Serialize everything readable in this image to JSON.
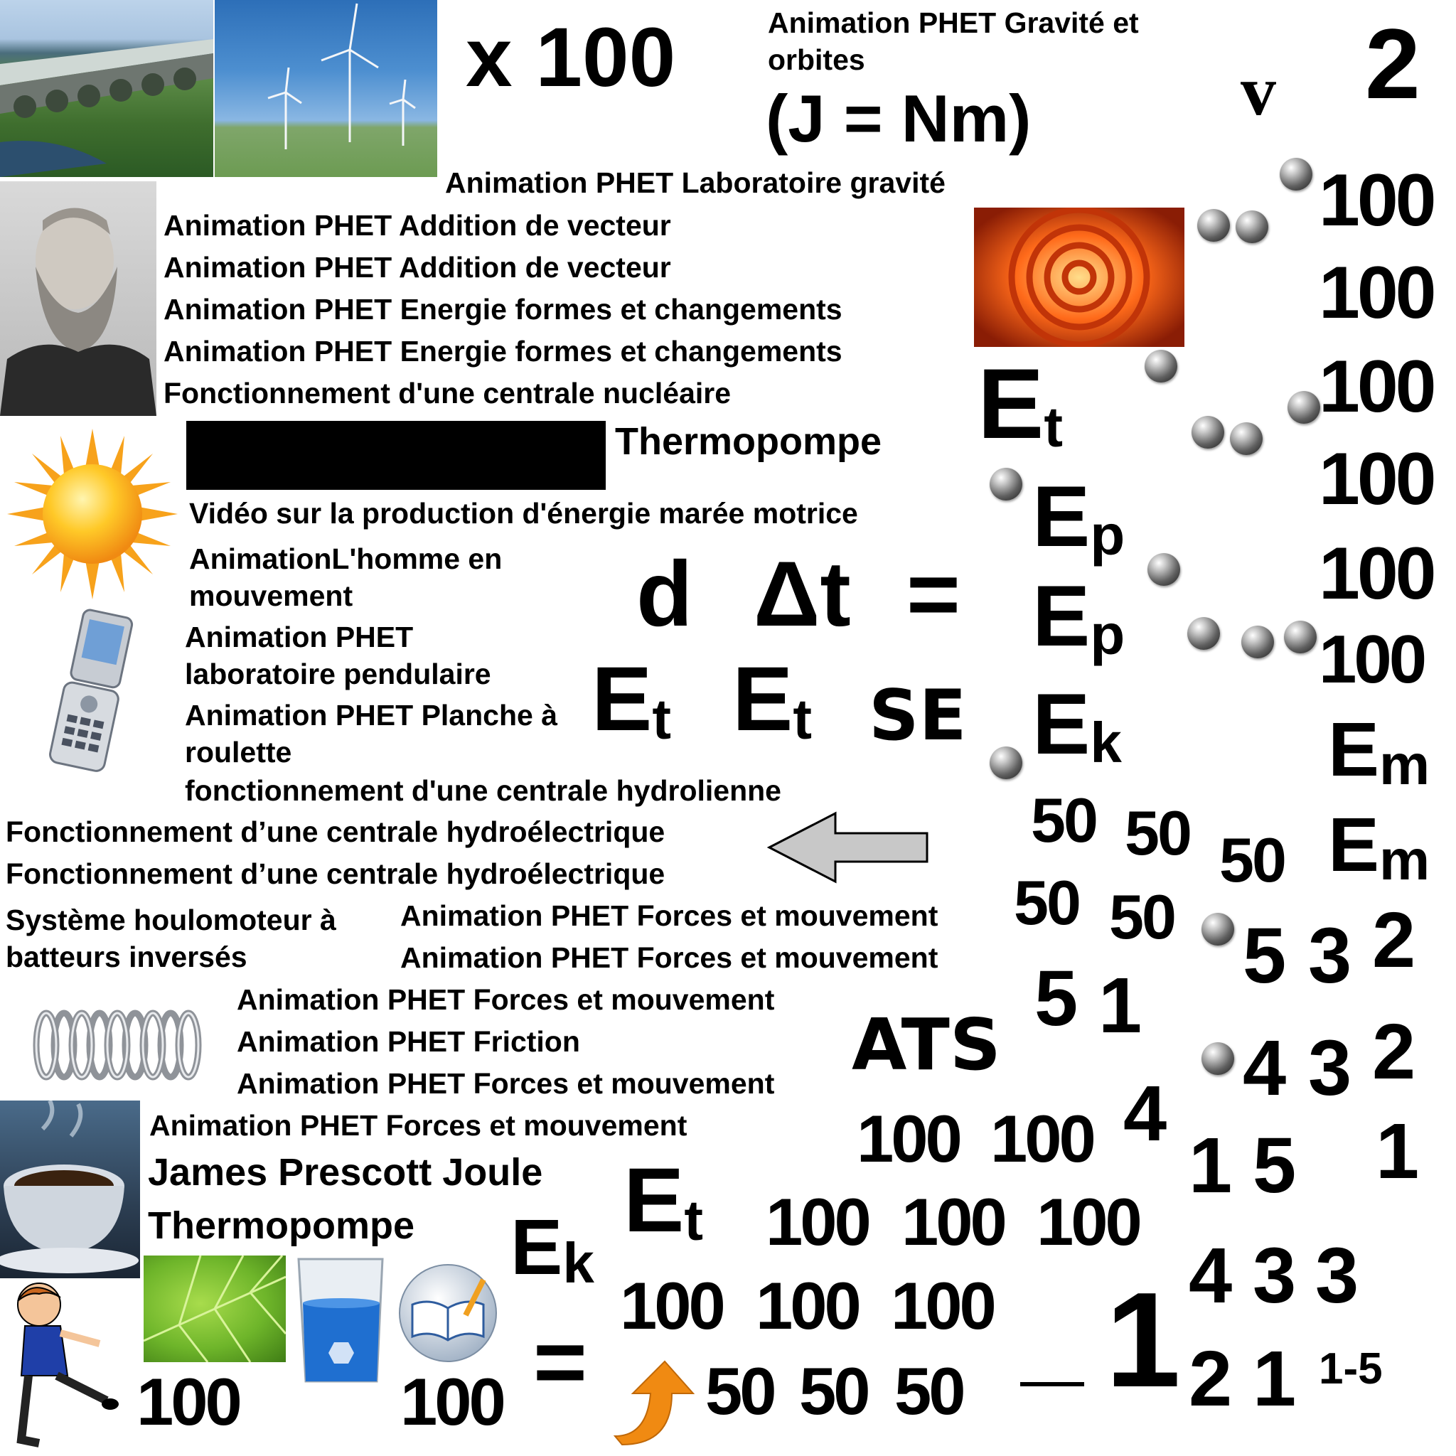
{
  "header": {
    "x100": "x 100",
    "gravity_orbits": "Animation PHET Gravité et orbites",
    "joule_unit": "(J = Nm)",
    "v": "v",
    "two": "2",
    "gravity_lab": "Animation PHET Laboratoire gravité"
  },
  "links_block1": [
    "Animation PHET Addition de vecteur",
    "Animation PHET Addition de vecteur",
    "Animation PHET Energie formes et changements",
    "Animation PHET Energie formes et changements",
    "Fonctionnement d'une centrale nucléaire"
  ],
  "thermopompe_top": "Thermopompe",
  "links_block2": {
    "tidal": "Vidéo sur la production d'énergie marée motrice",
    "man_moving": "AnimationL'homme en mouvement",
    "pendulum": "Animation PHET laboratoire pendulaire",
    "skate": "Animation PHET Planche à roulette",
    "hydrolienne": "fonctionnement d'une centrale hydrolienne",
    "hydro1": "Fonctionnement d’une centrale hydroélectrique",
    "hydro2": "Fonctionnement d’une centrale hydroélectrique",
    "wave": "Système houlomoteur à batteurs inversés"
  },
  "forces_links": [
    "Animation PHET Forces et mouvement",
    "Animation PHET Forces et mouvement",
    "Animation PHET Forces et mouvement",
    "Animation PHET Friction",
    "Animation PHET Forces et mouvement",
    "Animation PHET Forces et mouvement"
  ],
  "bottom_text": {
    "joule_name": "James Prescott Joule",
    "thermopompe": "Thermopompe"
  },
  "formula": {
    "d": "d",
    "delta_t": "Δt",
    "equals": "=",
    "E": "E",
    "sub_t": "t",
    "sub_p": "p",
    "sub_k": "k",
    "sub_m": "m",
    "se": "SE",
    "ats": "ATS",
    "dash": "—",
    "range": "1-5"
  },
  "right_column": [
    "100",
    "100",
    "100",
    "100",
    "100",
    "100"
  ],
  "numbers": {
    "n100": "100",
    "n50": "50",
    "n1": "1",
    "n2": "2",
    "n3": "3",
    "n4": "4",
    "n5": "5"
  },
  "colors": {
    "arrow_fill": "#c8c8c8",
    "orange_arrow": "#f08a12",
    "redacted": "#000000"
  }
}
